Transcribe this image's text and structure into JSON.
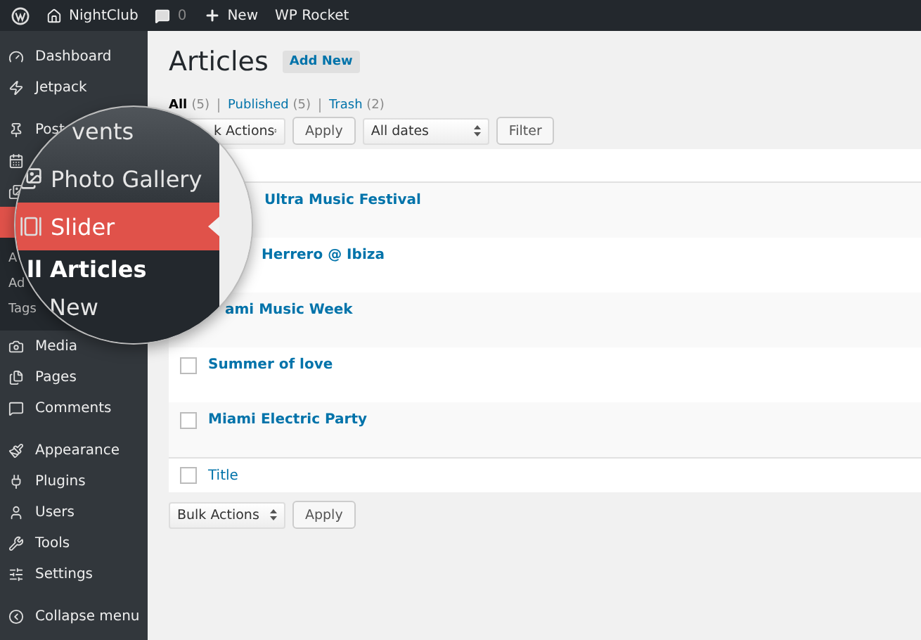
{
  "admin_bar": {
    "site": "NightClub",
    "comments": "0",
    "new": "New",
    "plugin": "WP Rocket"
  },
  "sidebar": {
    "groups": [
      [
        {
          "label": "Dashboard",
          "selected": false
        },
        {
          "label": "Jetpack",
          "selected": false
        }
      ],
      [
        {
          "label": "Post",
          "selected": false
        },
        {
          "selected": false
        },
        {
          "selected": false
        },
        {
          "selected": true,
          "children": [
            {
              "label": "A"
            },
            {
              "label": "Ad"
            },
            {
              "label": "Tags"
            }
          ]
        },
        {
          "label": "Media",
          "selected": false
        },
        {
          "label": "Pages",
          "selected": false
        },
        {
          "label": "Comments",
          "selected": false
        }
      ],
      [
        {
          "label": "Appearance",
          "selected": false
        },
        {
          "label": "Plugins",
          "selected": false
        },
        {
          "label": "Users",
          "selected": false
        },
        {
          "label": "Tools",
          "selected": false
        },
        {
          "label": "Settings",
          "selected": false
        }
      ]
    ],
    "collapse": "Collapse menu"
  },
  "magnifier": {
    "items": [
      {
        "label": "vents",
        "kind": "menu",
        "selected": false
      },
      {
        "label": "Photo Gallery",
        "kind": "menu",
        "selected": false
      },
      {
        "label": "Slider",
        "kind": "menu",
        "selected": true
      },
      {
        "label": "ll Articles",
        "kind": "sub",
        "selected": true
      },
      {
        "label": "New",
        "kind": "sub",
        "selected": false
      }
    ]
  },
  "page": {
    "title": "Articles",
    "add_new": "Add New",
    "filters": [
      {
        "label": "All",
        "count": "(5)",
        "selected": true
      },
      {
        "label": "Published",
        "count": "(5)",
        "selected": false
      },
      {
        "label": "Trash",
        "count": "(2)",
        "selected": false
      }
    ],
    "top_actions": {
      "bulk": "k Actions",
      "apply": "Apply",
      "dates": "All dates",
      "filter": "Filter"
    },
    "rows": [
      {
        "title": "Ultra Music Festival"
      },
      {
        "title": "Herrero @ Ibiza"
      },
      {
        "title": "ami Music Week"
      },
      {
        "title": "Summer of love",
        "checked": false
      },
      {
        "title": "Miami Electric Party",
        "checked": false
      }
    ],
    "footer": {
      "title": "Title",
      "checked": false
    },
    "bottom_actions": {
      "bulk": "Bulk Actions",
      "apply": "Apply"
    }
  }
}
